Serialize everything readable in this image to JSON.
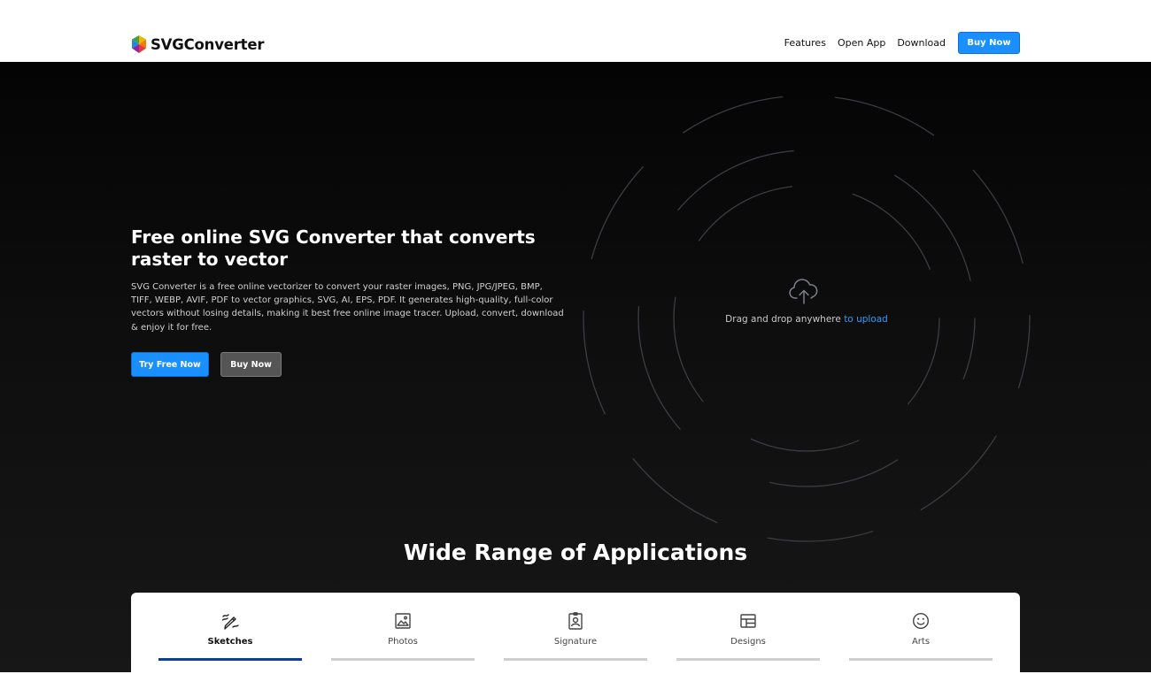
{
  "header": {
    "logo_text": "SVGConverter",
    "nav": [
      {
        "label": "Features"
      },
      {
        "label": "Open App"
      },
      {
        "label": "Download"
      }
    ],
    "buy_label": "Buy Now"
  },
  "hero": {
    "title": "Free online SVG Converter that converts raster to vector",
    "description": "SVG Converter is a free online vectorizer to convert your raster images, PNG, JPG/JPEG, BMP, TIFF, WEBP, AVIF, PDF to vector graphics, SVG, AI, EPS, PDF. It generates high-quality, full-color vectors without losing details, making it best free online image tracer. Upload, convert, download & enjoy it for free.",
    "try_label": "Try Free Now",
    "buy_label": "Buy Now",
    "upload": {
      "icon": "cloud-upload-icon",
      "text": "Drag and drop anywhere",
      "link": "to upload"
    }
  },
  "applications": {
    "title": "Wide Range of Applications",
    "tabs": [
      {
        "label": "Sketches",
        "icon": "pencil-sketch-icon",
        "active": true
      },
      {
        "label": "Photos",
        "icon": "image-icon",
        "active": false
      },
      {
        "label": "Signature",
        "icon": "id-badge-icon",
        "active": false
      },
      {
        "label": "Designs",
        "icon": "layout-icon",
        "active": false
      },
      {
        "label": "Arts",
        "icon": "smiley-icon",
        "active": false
      }
    ]
  },
  "colors": {
    "accent": "#1a8fff",
    "active_tab": "#0d3d9e",
    "link": "#2f9bff"
  }
}
